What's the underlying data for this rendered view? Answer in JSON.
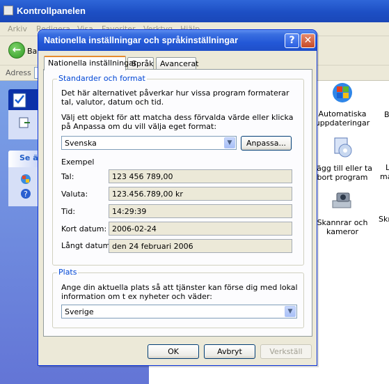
{
  "background_window": {
    "title": "Kontrollpanelen",
    "menu": [
      "Arkiv",
      "Redigera",
      "Visa",
      "Favoriter",
      "Verktyg",
      "Hjälp"
    ],
    "back_label": "Bak",
    "address_label": "Adress",
    "left_panel_header": "Se ä",
    "items": [
      {
        "label": "Automatiska uppdateringar",
        "icon": "windows-update-icon"
      },
      {
        "label": "Lägg till eller ta bort program",
        "icon": "add-remove-programs-icon"
      },
      {
        "label": "Skannrar och kameror",
        "icon": "scanner-camera-icon"
      }
    ],
    "edge_labels": [
      "Bi",
      "L",
      "ma",
      "Skr"
    ]
  },
  "dialog": {
    "title": "Nationella inställningar och språkinställningar",
    "tabs": [
      "Nationella inställningar",
      "Språk",
      "Avancerat"
    ],
    "active_tab": "Nationella inställningar",
    "standards_group": {
      "label": "Standarder och format",
      "description": "Det här alternativet påverkar hur vissa program formaterar tal, valutor, datum och tid.",
      "select_prompt": "Välj ett objekt för att matcha dess förvalda värde eller klicka på Anpassa om du vill välja eget format:",
      "selected_format": "Svenska",
      "customize_button": "Anpassa...",
      "examples_heading": "Exempel",
      "examples": [
        {
          "label": "Tal:",
          "value": "123 456 789,00"
        },
        {
          "label": "Valuta:",
          "value": "123.456.789,00 kr"
        },
        {
          "label": "Tid:",
          "value": "14:29:39"
        },
        {
          "label": "Kort datum:",
          "value": "2006-02-24"
        },
        {
          "label": "Långt datum:",
          "value": "den 24 februari 2006"
        }
      ]
    },
    "location_group": {
      "label": "Plats",
      "description": "Ange din aktuella plats så att tjänster kan förse dig med lokal information om t ex nyheter och väder:",
      "selected_location": "Sverige"
    },
    "buttons": {
      "ok": "OK",
      "cancel": "Avbryt",
      "apply": "Verkställ"
    }
  }
}
